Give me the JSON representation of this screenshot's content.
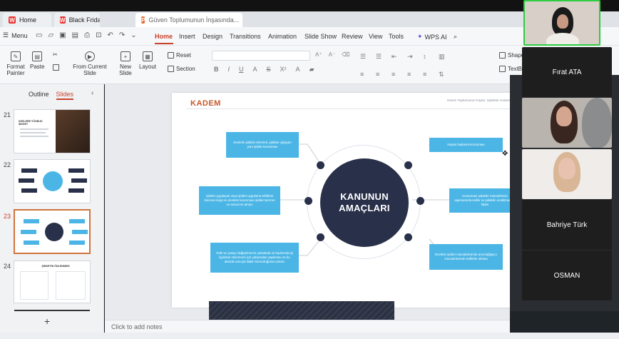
{
  "tabs": [
    {
      "label": "Home",
      "logo": "W"
    },
    {
      "label": "Black Friday sale",
      "logo": "W"
    },
    {
      "label": "Güven Toplumunun İnşasında...",
      "logo": "P"
    }
  ],
  "menu": {
    "menu_label": "Menu",
    "items": [
      "Home",
      "Insert",
      "Design",
      "Transitions",
      "Animation",
      "Slide Show",
      "Review",
      "View",
      "Tools"
    ],
    "ai_label": "WPS AI"
  },
  "toolbar": {
    "format_painter": "Format Painter",
    "paste": "Paste",
    "from_current_slide": "From Current Slide",
    "new_slide": "New Slide",
    "layout": "Layout",
    "reset": "Reset",
    "section": "Section",
    "shapes": "Shape",
    "textbox": "TextBo"
  },
  "slide_panel": {
    "tab_outline": "Outline",
    "tab_slides": "Slides",
    "thumbnails": [
      {
        "number": "21",
        "title": "KESLERE YÖNELİK ŞİDDET"
      },
      {
        "number": "22",
        "title": ""
      },
      {
        "number": "23",
        "title": "KANUNUN AMAÇLARI"
      },
      {
        "number": "24",
        "title": "ŞİDDETİN ÖNLENMESİ"
      }
    ],
    "add_slide": "+"
  },
  "slide": {
    "brand": "KADEM",
    "header_right": "Güven Toplumunun İnşası: Şiddetin Anatomisi ve Ç...",
    "center_title_line1": "KANUNUN",
    "center_title_line2": "AMAÇLARI",
    "boxes": [
      "Devletin şiddeti önlemek, şiddete uğrayan yani şiddet korunması",
      "Şiddet uygulayan veya şiddet uygulama tehlikesi bulunan kişiyi ve devletin korunması şiddet tarzının ve amacının amacı",
      "Yetki ve yasayı değiştirmenin yasalarda ve kadınında işi ilgisinde önlenmesi için çalışmaları yapılması ve bu alanda sonuçta ilişkin korunduğunun amacı",
      "Hayatı başlama korunması",
      "Korunması şiddetle mücadelenin aşamasında tedbir ve şiddetin azaltılmasına ilişkin",
      "Devletin şiddet mücadelesinde ana bağlayıcı mücadelesinde tedbirler alması"
    ],
    "colors": {
      "box": "#4bb6e6",
      "center": "#28304a",
      "brand": "#c8572b"
    }
  },
  "notes_placeholder": "Click to add notes",
  "participants": [
    {
      "name": "Fırat ATA"
    },
    {
      "name": "Bahriye Türk"
    },
    {
      "name": "OSMAN"
    }
  ]
}
